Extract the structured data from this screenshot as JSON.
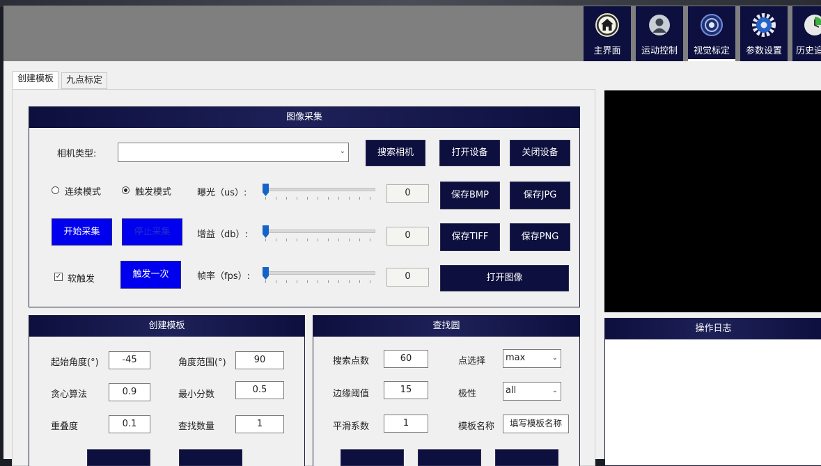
{
  "nav": {
    "home": "主界面",
    "motion": "运动控制",
    "vision": "视觉标定",
    "params": "参数设置",
    "history": "历史追"
  },
  "tabs": [
    "创建模板",
    "九点标定"
  ],
  "acquisition": {
    "title": "图像采集",
    "camera_type_label": "相机类型:",
    "camera_type_value": "",
    "search_camera": "搜索相机",
    "open_device": "打开设备",
    "close_device": "关闭设备",
    "continuous_mode": "连续模式",
    "trigger_mode": "触发模式",
    "exposure_label": "曝光（us）:",
    "exposure_value": "0",
    "gain_label": "增益（db）:",
    "gain_value": "0",
    "fps_label": "帧率（fps）:",
    "fps_value": "0",
    "save_bmp": "保存BMP",
    "save_jpg": "保存JPG",
    "save_tiff": "保存TIFF",
    "save_png": "保存PNG",
    "start_capture": "开始采集",
    "stop_capture": "停止采集",
    "soft_trigger": "软触发",
    "trigger_once": "触发一次",
    "open_image": "打开图像",
    "trigger_mode_selected": true,
    "soft_trigger_checked": true
  },
  "template": {
    "title": "创建模板",
    "start_angle_label": "起始角度(°)",
    "start_angle": "-45",
    "angle_range_label": "角度范围(°)",
    "angle_range": "90",
    "greedy_label": "贪心算法",
    "greedy": "0.9",
    "min_score_label": "最小分数",
    "min_score": "0.5",
    "overlap_label": "重叠度",
    "overlap": "0.1",
    "find_count_label": "查找数量",
    "find_count": "1"
  },
  "find_circle": {
    "title": "查找圆",
    "search_points_label": "搜索点数",
    "search_points": "60",
    "point_select_label": "点选择",
    "point_select": "max",
    "edge_threshold_label": "边缘阈值",
    "edge_threshold": "15",
    "polarity_label": "极性",
    "polarity": "all",
    "smooth_label": "平滑系数",
    "smooth": "1",
    "template_name_label": "模板名称",
    "template_name_placeholder": "填写模板名称"
  },
  "log": {
    "title": "操作日志"
  },
  "colors": {
    "navy": "#0d0f3e",
    "blue_button": "#0000ee",
    "header_gray": "#7f7f7f"
  }
}
